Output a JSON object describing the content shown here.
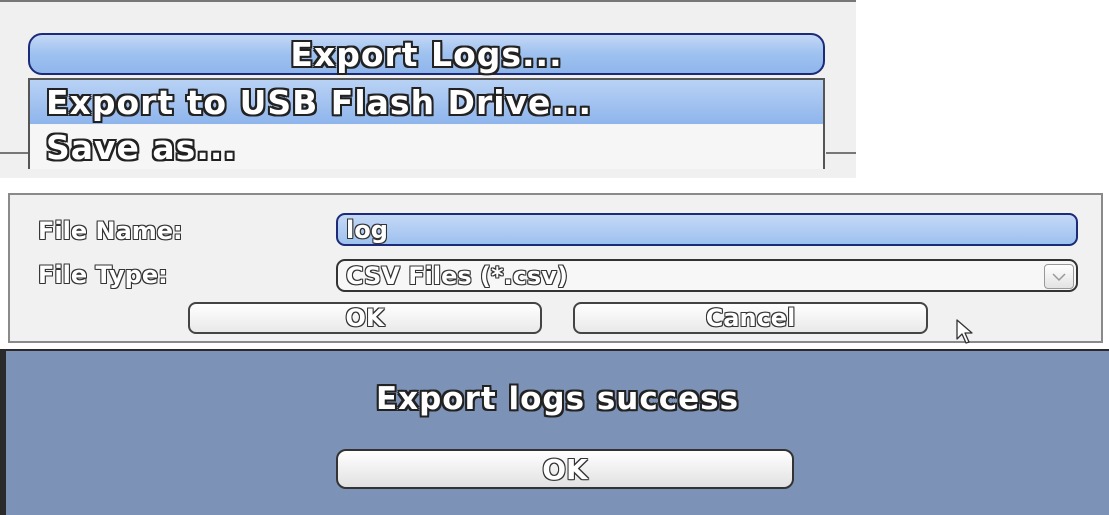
{
  "menu": {
    "export_logs_label": "Export Logs...",
    "items": [
      {
        "label": "Export to USB Flash Drive..."
      },
      {
        "label": "Save as..."
      }
    ]
  },
  "dialog": {
    "file_name_label": "File Name:",
    "file_name_value": "log",
    "file_type_label": "File Type:",
    "file_type_value": "CSV Files (*.csv)",
    "ok_label": "OK",
    "cancel_label": "Cancel",
    "dropdown_icon": "chevron-down-icon",
    "cursor_icon": "mouse-cursor-icon"
  },
  "success": {
    "message": "Export logs success",
    "ok_label": "OK"
  },
  "colors": {
    "highlight_blue": "#9ec1ef",
    "success_background": "#7c93b7",
    "dialog_background": "#f1f1f1"
  }
}
